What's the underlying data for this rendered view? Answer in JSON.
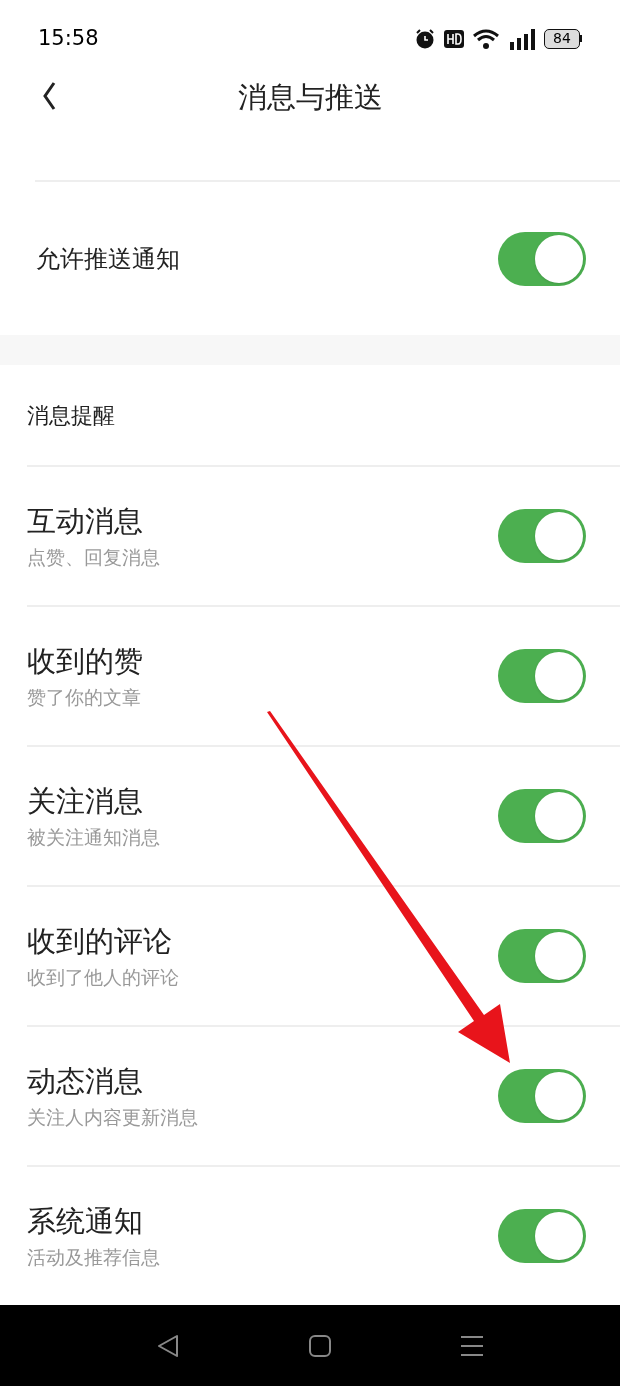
{
  "status_bar": {
    "time": "15:58",
    "battery": "84"
  },
  "nav": {
    "title": "消息与推送"
  },
  "push": {
    "label": "允许推送通知",
    "on": true
  },
  "section": {
    "title": "消息提醒"
  },
  "items": [
    {
      "title": "互动消息",
      "subtitle": "点赞、回复消息",
      "on": true
    },
    {
      "title": "收到的赞",
      "subtitle": "赞了你的文章",
      "on": true
    },
    {
      "title": "关注消息",
      "subtitle": "被关注通知消息",
      "on": true
    },
    {
      "title": "收到的评论",
      "subtitle": "收到了他人的评论",
      "on": true
    },
    {
      "title": "动态消息",
      "subtitle": "关注人内容更新消息",
      "on": true
    },
    {
      "title": "系统通知",
      "subtitle": "活动及推荐信息",
      "on": true
    }
  ]
}
